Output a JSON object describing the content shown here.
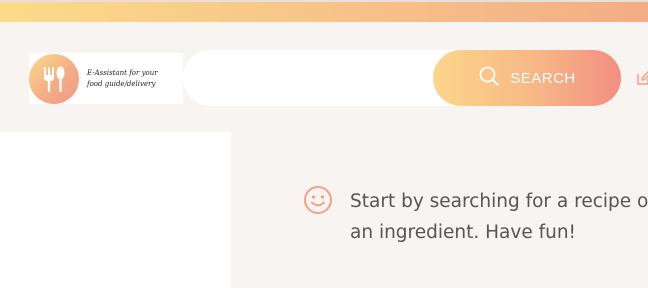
{
  "header": {
    "logo_text": "E-Assistant for your\nfood guide/delivery",
    "search": {
      "placeholder": "",
      "value": "",
      "button_label": "SEARCH"
    }
  },
  "main": {
    "empty_message_line1": "Start by searching for a recipe or",
    "empty_message_line2": "an ingredient. Have fun!"
  },
  "icons": {
    "logo": "fork-spoon-icon",
    "search": "search-icon",
    "edit": "edit-icon",
    "empty": "smile-icon"
  },
  "colors": {
    "gradient_start": "#fbdb89",
    "gradient_end": "#f28f82",
    "accent_icon": "#f4a27f",
    "background": "#f8f4f1"
  }
}
